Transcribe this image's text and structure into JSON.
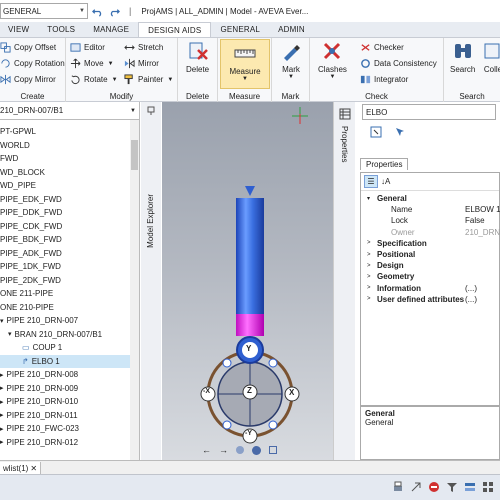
{
  "titlebar": {
    "combo_value": "GENERAL",
    "separator": "|",
    "title": "ProjAMS | ALL_ADMIN | Model - AVEVA Ever..."
  },
  "tabs": [
    "VIEW",
    "TOOLS",
    "MANAGE",
    "DESIGN AIDS",
    "GENERAL",
    "ADMIN"
  ],
  "ribbon": {
    "create": {
      "label": "Create",
      "items": [
        "Copy Offset",
        "Copy Rotation",
        "Copy Mirror"
      ]
    },
    "modify": {
      "label": "Modify",
      "col1": [
        "Editor",
        "Move",
        "Rotate"
      ],
      "col2": [
        "Stretch",
        "Mirror",
        "Painter"
      ]
    },
    "delete": {
      "button": "Delete",
      "label": "Delete"
    },
    "measure": {
      "button": "Measure",
      "label": "Measure"
    },
    "mark": {
      "button": "Mark",
      "label": "Mark"
    },
    "check": {
      "label": "Check",
      "clashes": "Clashes",
      "items": [
        "Checker",
        "Data Consistency",
        "Integrator"
      ]
    },
    "search": {
      "label": "Search",
      "search_button": "Search",
      "collect_button": "Colle"
    }
  },
  "left_panel": {
    "header": "210_DRN-007/B1",
    "side_tab": "Model Explorer",
    "tree": [
      "PT-GPWL",
      "WORLD",
      "FWD",
      "WD_BLOCK",
      "WD_PIPE",
      "PIPE_EDK_FWD",
      "PIPE_DDK_FWD",
      "PIPE_CDK_FWD",
      "PIPE_BDK_FWD",
      "PIPE_ADK_FWD",
      "PIPE_1DK_FWD",
      "PIPE_2DK_FWD",
      "ONE 211-PIPE",
      "ONE 210-PIPE",
      "PIPE 210_DRN-007",
      "BRAN 210_DRN-007/B1",
      "COUP 1",
      "ELBO 1",
      "PIPE 210_DRN-008",
      "PIPE 210_DRN-009",
      "PIPE 210_DRN-010",
      "PIPE 210_DRN-011",
      "PIPE 210_FWC-023",
      "PIPE 210_DRN-012"
    ]
  },
  "viewport": {
    "gizmo_labels": [
      "Y",
      "-X",
      "Z",
      "X",
      "-Y"
    ]
  },
  "right_panel": {
    "side_tab": "Properties",
    "element": "ELBO",
    "tab": "Properties",
    "properties": [
      {
        "key": "General",
        "value": "",
        "kind": "group-open"
      },
      {
        "key": "Name",
        "value": "ELBOW 1",
        "kind": "field"
      },
      {
        "key": "Lock",
        "value": "False",
        "kind": "field"
      },
      {
        "key": "Owner",
        "value": "210_DRN",
        "kind": "field-grey"
      },
      {
        "key": "Specification",
        "value": "",
        "kind": "group"
      },
      {
        "key": "Positional",
        "value": "",
        "kind": "group"
      },
      {
        "key": "Design",
        "value": "",
        "kind": "group"
      },
      {
        "key": "Geometry",
        "value": "",
        "kind": "group"
      },
      {
        "key": "Information",
        "value": "(...)",
        "kind": "group"
      },
      {
        "key": "User defined attributes",
        "value": "(...)",
        "kind": "group"
      }
    ],
    "desc_title": "General",
    "desc_text": "General"
  },
  "statusbar": {
    "doc_tab": "wlist(1)"
  },
  "colors": {
    "accent": "#2b579a",
    "pipe": "#3a6fe0",
    "selection": "#cde6f7",
    "measure": "#fce9b0"
  }
}
